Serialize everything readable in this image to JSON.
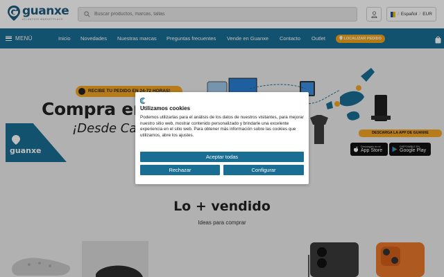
{
  "header": {
    "logo_name": "guanxe",
    "logo_tagline": "Atlántico Marketplace",
    "search_placeholder": "Buscar productos, marcas, tallas",
    "language": "Español",
    "currency": "EUR",
    "separator": "/"
  },
  "nav": {
    "menu_label": "MENÚ",
    "links": [
      "Inicio",
      "Novedades",
      "Nuestras marcas",
      "Preguntas frecuentes",
      "Vende en Guanxe",
      "Contacto",
      "Outlet"
    ],
    "track_label": "LOCALIZAR PEDIDO"
  },
  "banner": {
    "ribbon": "RECIBE TU PEDIDO EN 24-72 HORAS!",
    "headline": "Compra en Guanxe",
    "subline": "¡Desde Canarias!",
    "tile_logo": "guanxe",
    "app_title": "DESCARGA LA APP DE GUANXE",
    "app_store_small": "Descárgalo en el",
    "app_store_big": "App Store",
    "play_small": "DISPONIBLE EN",
    "play_big": "Google Play"
  },
  "products": {
    "title": "Lo + vendido",
    "subtitle": "Ideas para comprar"
  },
  "cookie": {
    "title": "Utilizamos cookies",
    "text": "Podemos utilizarlas para el análisis de los datos de nuestros visitantes, para mejorar nuestro sitio web, mostrar contenido personalizado y brindarle una excelente experiencia en el sitio web. Para obtener más información sobre las cookies que utilizamos, abre los ajustes.",
    "accept": "Aceptar todas",
    "reject": "Rechazar",
    "configure": "Configurar"
  },
  "colors": {
    "brand_blue": "#1a6e94",
    "accent_orange": "#f5a623",
    "logo_blue": "#1f5b7f"
  },
  "icons": [
    "logo-pin-icon",
    "search-icon",
    "user-icon",
    "flag-icon",
    "hamburger-icon",
    "location-pin-icon",
    "cart-icon",
    "apple-icon",
    "google-play-icon",
    "cookie-icon"
  ]
}
